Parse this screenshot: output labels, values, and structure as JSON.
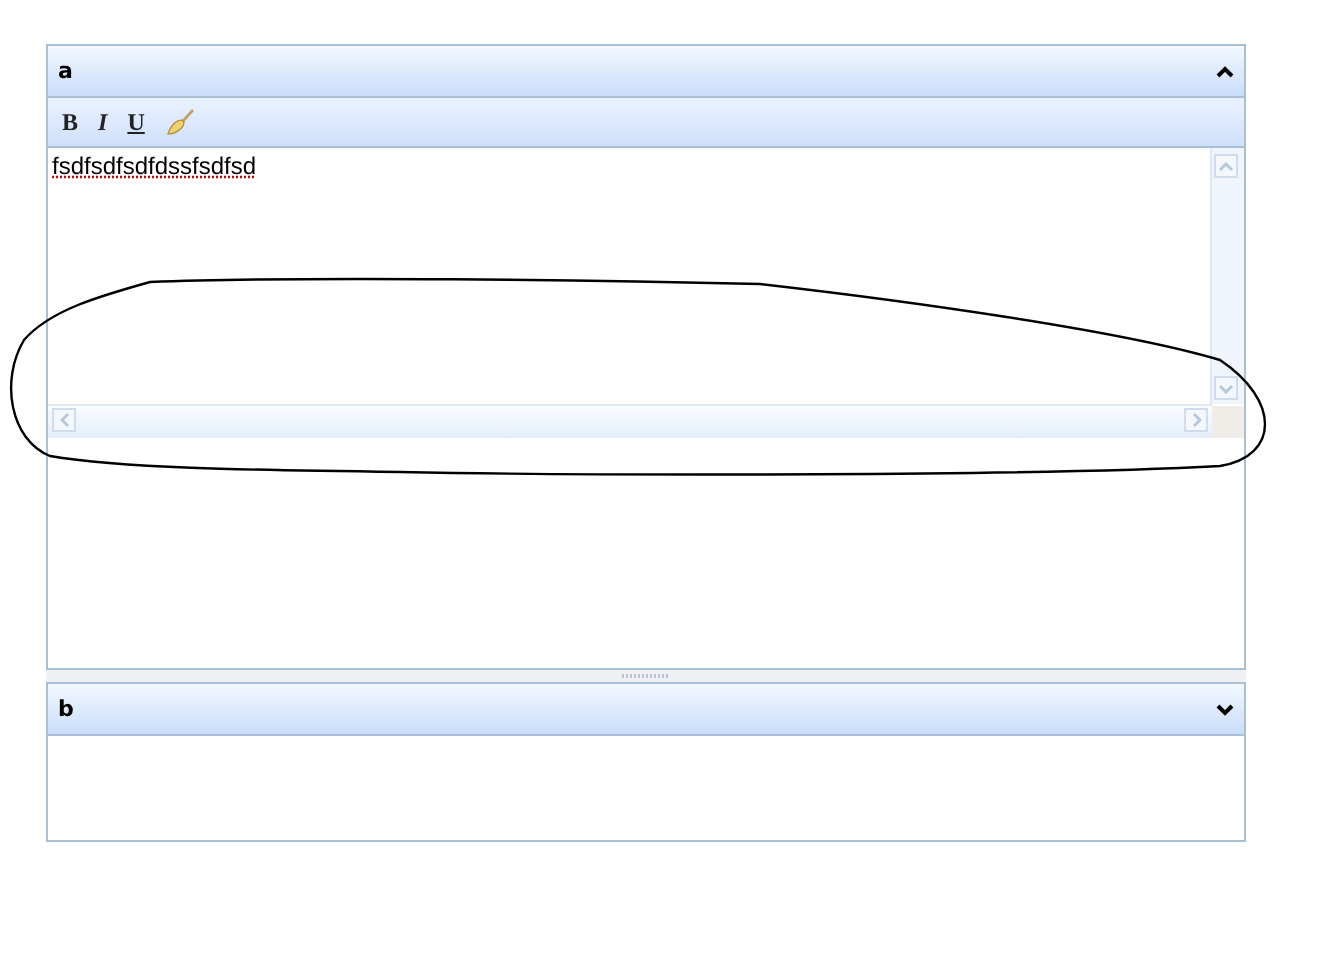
{
  "panels": [
    {
      "title": "a",
      "expanded": true,
      "toolbar": [
        {
          "kind": "bold",
          "label": "B"
        },
        {
          "kind": "italic",
          "label": "I"
        },
        {
          "kind": "underline",
          "label": "U"
        },
        {
          "kind": "brush"
        }
      ],
      "editor_text": "fsdfsdfsdfdssfsdfsd"
    },
    {
      "title": "b",
      "expanded": false
    }
  ]
}
